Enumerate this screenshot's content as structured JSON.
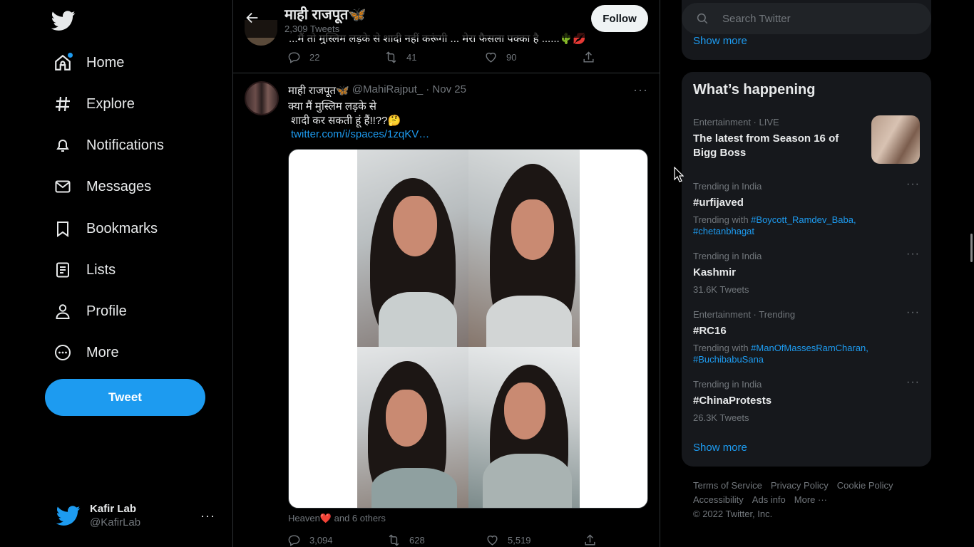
{
  "sidebar": {
    "items": [
      {
        "label": "Home"
      },
      {
        "label": "Explore"
      },
      {
        "label": "Notifications"
      },
      {
        "label": "Messages"
      },
      {
        "label": "Bookmarks"
      },
      {
        "label": "Lists"
      },
      {
        "label": "Profile"
      },
      {
        "label": "More"
      }
    ],
    "tweet_button": "Tweet",
    "account": {
      "name": "Kafir Lab",
      "handle": "@KafirLab"
    }
  },
  "header": {
    "name": "माही राजपूत🦋",
    "tweet_count": "2,309 Tweets",
    "follow_label": "Follow"
  },
  "prev_tweet": {
    "text": "...मैं तो मुस्लिम लड़के से शादी नहीं करूंगी ... मेरा फैसला पक्का है ......🌵💋",
    "reply_count": "22",
    "retweet_count": "41",
    "like_count": "90"
  },
  "tweet": {
    "name": "माही राजपूत🦋",
    "handle": "@MahiRajput_",
    "date": "· Nov 25",
    "line1": "क्या मैं मुस्लिम लड़के से",
    "line2": " शादी कर सकती हूं हैं!!??🤔",
    "link": "twitter.com/i/spaces/1zqKV…",
    "liked_by_name": "Heaven",
    "liked_by_heart": "❤️",
    "liked_by_rest": " and 6 others",
    "reply_count": "3,094",
    "retweet_count": "628",
    "like_count": "5,519"
  },
  "right": {
    "search_placeholder": "Search Twitter",
    "top_show_more": "Show more",
    "trends_title": "What’s happening",
    "trends": [
      {
        "context": "Entertainment · LIVE",
        "title": "The latest from Season 16 of Bigg Boss",
        "sub": "",
        "tags": []
      },
      {
        "context": "Trending in India",
        "title": "#urfijaved",
        "sub": "Trending with ",
        "tags": [
          "#Boycott_Ramdev_Baba,",
          "#chetanbhagat"
        ]
      },
      {
        "context": "Trending in India",
        "title": "Kashmir",
        "sub": "31.6K Tweets",
        "tags": []
      },
      {
        "context": "Entertainment · Trending",
        "title": "#RC16",
        "sub": "Trending with ",
        "tags": [
          "#ManOfMassesRamCharan,",
          "#BuchibabuSana"
        ]
      },
      {
        "context": "Trending in India",
        "title": "#ChinaProtests",
        "sub": "26.3K Tweets",
        "tags": []
      }
    ],
    "show_more": "Show more",
    "footer": {
      "links": [
        "Terms of Service",
        "Privacy Policy",
        "Cookie Policy",
        "Accessibility",
        "Ads info",
        "More ···"
      ],
      "copyright": "© 2022 Twitter, Inc."
    }
  },
  "colors": {
    "accent": "#1d9bf0",
    "background": "#000000",
    "card": "#16181c",
    "muted": "#71767b",
    "text": "#e7e9ea"
  }
}
